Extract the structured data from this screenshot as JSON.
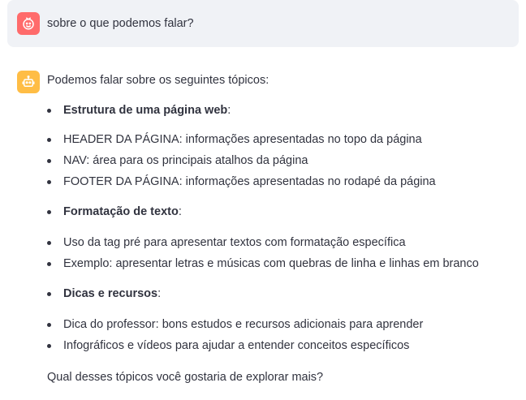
{
  "user_message": {
    "avatar_icon": "smiley-face-icon",
    "avatar_color": "#ff6b6b",
    "text": "sobre o que podemos falar?"
  },
  "assistant_message": {
    "avatar_icon": "robot-icon",
    "avatar_color": "#ffbd45",
    "intro": "Podemos falar sobre os seguintes tópicos:",
    "sections": [
      {
        "heading": "Estrutura de uma página web",
        "items": [
          "HEADER DA PÁGINA: informações apresentadas no topo da página",
          "NAV: área para os principais atalhos da página",
          "FOOTER DA PÁGINA: informações apresentadas no rodapé da página"
        ]
      },
      {
        "heading": "Formatação de texto",
        "items": [
          "Uso da tag pré para apresentar textos com formatação específica",
          "Exemplo: apresentar letras e músicas com quebras de linha e linhas em branco"
        ]
      },
      {
        "heading": "Dicas e recursos",
        "items": [
          "Dica do professor: bons estudos e recursos adicionais para aprender",
          "Infográficos e vídeos para ajudar a entender conceitos específicos"
        ]
      }
    ],
    "closing": "Qual desses tópicos você gostaria de explorar mais?"
  }
}
